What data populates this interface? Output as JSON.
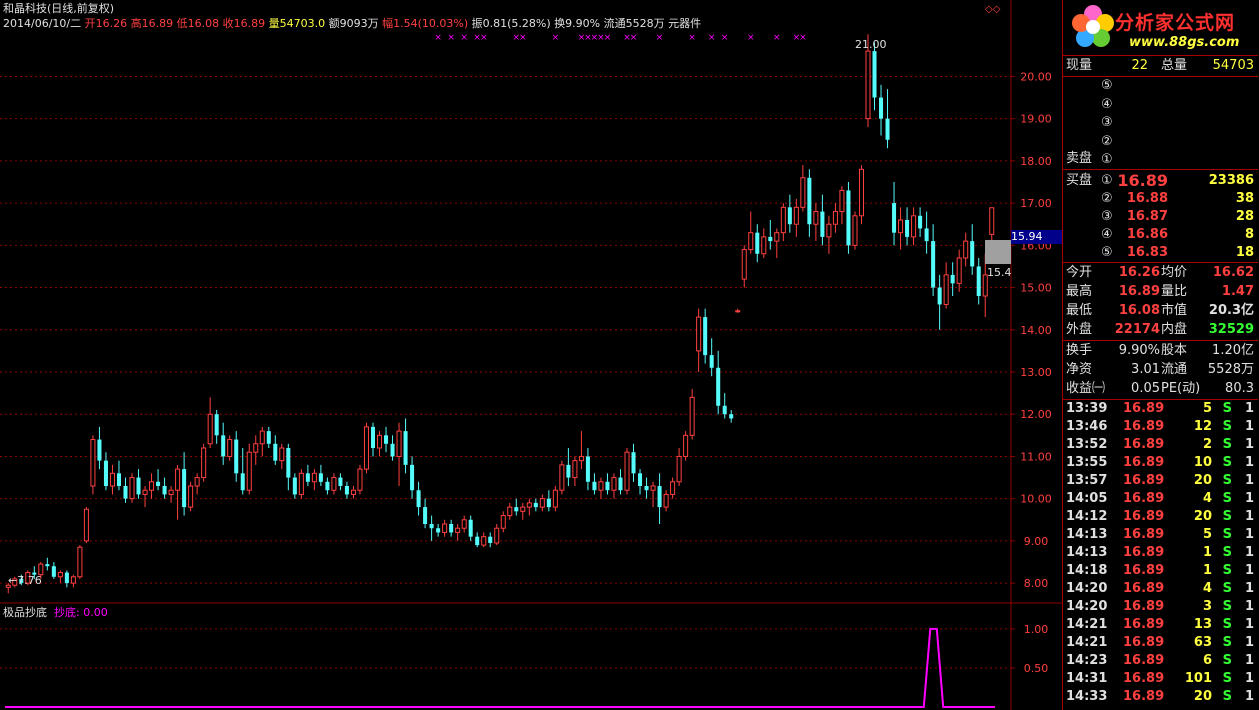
{
  "header": {
    "stock_name": "和晶科技(日线,前复权)",
    "date": "2014/06/10/二",
    "open_label": "开",
    "open": "16.26",
    "high_label": "高",
    "high": "16.89",
    "low_label": "低",
    "low": "16.08",
    "close_label": "收",
    "close": "16.89",
    "vol_label": "量",
    "vol": "54703.0",
    "amount_label": "额",
    "amount": "9093万",
    "chg_label": "幅",
    "chg": "1.54(10.03%)",
    "amp": "振0.81(5.28%)",
    "turnover": "换9.90%",
    "float": "流通5528万",
    "sector": "元器件"
  },
  "annotations": {
    "max_label": "21.00",
    "min_label": "7.76",
    "price_tag": "15.94",
    "right_label": "15.4"
  },
  "indicator": {
    "name": "极品抄底",
    "series_label": "抄底: 0.00"
  },
  "chart_data": [
    {
      "type": "candlestick",
      "y_ticks": [
        "20.00",
        "19.00",
        "18.00",
        "17.00",
        "16.00",
        "15.00",
        "14.00",
        "13.00",
        "12.00",
        "11.00",
        "10.00",
        "9.00",
        "8.00"
      ],
      "ylim": [
        7.6,
        21.1
      ],
      "candles": [
        [
          7.9,
          8.0,
          7.76,
          7.95
        ],
        [
          7.95,
          8.15,
          7.9,
          8.1
        ],
        [
          8.1,
          8.2,
          7.95,
          8.0
        ],
        [
          8.0,
          8.3,
          7.95,
          8.25
        ],
        [
          8.25,
          8.4,
          8.1,
          8.2
        ],
        [
          8.2,
          8.5,
          8.1,
          8.45
        ],
        [
          8.45,
          8.6,
          8.3,
          8.4
        ],
        [
          8.4,
          8.5,
          8.1,
          8.15
        ],
        [
          8.15,
          8.3,
          8.0,
          8.25
        ],
        [
          8.25,
          8.3,
          7.9,
          8.0
        ],
        [
          8.0,
          8.2,
          7.9,
          8.15
        ],
        [
          8.15,
          8.9,
          8.1,
          8.85
        ],
        [
          9.0,
          9.8,
          8.95,
          9.75
        ],
        [
          10.3,
          11.5,
          10.1,
          11.4
        ],
        [
          11.4,
          11.7,
          10.7,
          10.9
        ],
        [
          10.9,
          11.1,
          10.2,
          10.3
        ],
        [
          10.3,
          10.8,
          10.1,
          10.6
        ],
        [
          10.6,
          10.9,
          10.2,
          10.3
        ],
        [
          10.3,
          10.5,
          9.9,
          10.0
        ],
        [
          10.0,
          10.6,
          9.9,
          10.5
        ],
        [
          10.5,
          10.7,
          10.0,
          10.1
        ],
        [
          10.1,
          10.3,
          9.8,
          10.2
        ],
        [
          10.2,
          10.6,
          10.0,
          10.4
        ],
        [
          10.4,
          10.7,
          10.2,
          10.3
        ],
        [
          10.3,
          10.5,
          10.0,
          10.1
        ],
        [
          10.1,
          10.3,
          9.9,
          10.2
        ],
        [
          10.2,
          10.8,
          9.5,
          10.7
        ],
        [
          10.7,
          11.1,
          9.6,
          9.8
        ],
        [
          9.8,
          10.4,
          9.7,
          10.3
        ],
        [
          10.3,
          10.6,
          10.1,
          10.5
        ],
        [
          10.5,
          11.3,
          10.4,
          11.2
        ],
        [
          11.3,
          12.4,
          11.2,
          12.0
        ],
        [
          12.0,
          12.1,
          11.3,
          11.5
        ],
        [
          11.5,
          11.8,
          10.8,
          11.0
        ],
        [
          11.0,
          11.5,
          10.9,
          11.4
        ],
        [
          11.4,
          11.6,
          10.4,
          10.6
        ],
        [
          10.6,
          11.2,
          10.1,
          10.2
        ],
        [
          10.2,
          11.3,
          10.1,
          11.1
        ],
        [
          11.1,
          11.5,
          10.8,
          11.3
        ],
        [
          11.3,
          11.7,
          11.0,
          11.6
        ],
        [
          11.6,
          11.7,
          11.2,
          11.3
        ],
        [
          11.3,
          11.5,
          10.8,
          10.9
        ],
        [
          10.9,
          11.3,
          10.7,
          11.2
        ],
        [
          11.2,
          11.3,
          10.2,
          10.5
        ],
        [
          10.5,
          10.6,
          10.0,
          10.1
        ],
        [
          10.1,
          10.7,
          10.0,
          10.6
        ],
        [
          10.6,
          10.8,
          10.3,
          10.4
        ],
        [
          10.4,
          10.7,
          10.2,
          10.6
        ],
        [
          10.6,
          10.8,
          10.3,
          10.4
        ],
        [
          10.4,
          10.5,
          10.1,
          10.2
        ],
        [
          10.2,
          10.6,
          10.1,
          10.5
        ],
        [
          10.5,
          10.6,
          10.2,
          10.3
        ],
        [
          10.3,
          10.4,
          10.0,
          10.1
        ],
        [
          10.1,
          10.3,
          10.0,
          10.2
        ],
        [
          10.2,
          10.8,
          10.1,
          10.7
        ],
        [
          10.7,
          11.8,
          10.6,
          11.7
        ],
        [
          11.7,
          11.8,
          11.0,
          11.2
        ],
        [
          11.2,
          11.6,
          11.0,
          11.5
        ],
        [
          11.5,
          11.7,
          11.1,
          11.3
        ],
        [
          11.3,
          11.5,
          10.9,
          11.0
        ],
        [
          11.0,
          11.8,
          10.3,
          11.6
        ],
        [
          11.6,
          11.9,
          10.6,
          10.8
        ],
        [
          10.8,
          11.0,
          10.0,
          10.2
        ],
        [
          10.2,
          10.4,
          9.6,
          9.8
        ],
        [
          9.8,
          10.0,
          9.3,
          9.4
        ],
        [
          9.4,
          9.6,
          9.0,
          9.3
        ],
        [
          9.3,
          9.4,
          9.1,
          9.2
        ],
        [
          9.2,
          9.5,
          9.1,
          9.4
        ],
        [
          9.4,
          9.5,
          9.1,
          9.2
        ],
        [
          9.2,
          9.4,
          9.0,
          9.3
        ],
        [
          9.3,
          9.6,
          9.2,
          9.5
        ],
        [
          9.5,
          9.6,
          9.0,
          9.1
        ],
        [
          9.1,
          9.2,
          8.85,
          8.9
        ],
        [
          8.9,
          9.2,
          8.85,
          9.1
        ],
        [
          9.1,
          9.2,
          8.85,
          8.95
        ],
        [
          8.95,
          9.4,
          8.9,
          9.3
        ],
        [
          9.3,
          9.7,
          9.2,
          9.6
        ],
        [
          9.6,
          9.9,
          9.5,
          9.8
        ],
        [
          9.8,
          10.0,
          9.6,
          9.7
        ],
        [
          9.7,
          9.9,
          9.5,
          9.8
        ],
        [
          9.8,
          10.0,
          9.6,
          9.9
        ],
        [
          9.9,
          10.0,
          9.7,
          9.8
        ],
        [
          9.8,
          10.1,
          9.7,
          10.0
        ],
        [
          10.0,
          10.2,
          9.7,
          9.8
        ],
        [
          9.8,
          10.3,
          9.7,
          10.2
        ],
        [
          10.2,
          10.9,
          10.1,
          10.8
        ],
        [
          10.8,
          11.2,
          10.3,
          10.5
        ],
        [
          10.5,
          11.0,
          10.3,
          10.9
        ],
        [
          10.9,
          11.6,
          10.7,
          11.0
        ],
        [
          11.0,
          11.2,
          10.2,
          10.4
        ],
        [
          10.4,
          10.6,
          10.1,
          10.2
        ],
        [
          10.2,
          10.5,
          10.0,
          10.4
        ],
        [
          10.4,
          10.6,
          10.1,
          10.2
        ],
        [
          10.2,
          10.6,
          10.0,
          10.5
        ],
        [
          10.5,
          10.7,
          10.1,
          10.2
        ],
        [
          10.2,
          11.2,
          10.1,
          11.1
        ],
        [
          11.1,
          11.3,
          10.4,
          10.6
        ],
        [
          10.6,
          10.7,
          10.1,
          10.3
        ],
        [
          10.3,
          10.5,
          10.0,
          10.2
        ],
        [
          10.2,
          10.4,
          9.8,
          10.3
        ],
        [
          10.3,
          10.6,
          9.4,
          9.8
        ],
        [
          9.8,
          10.2,
          9.7,
          10.1
        ],
        [
          10.1,
          10.5,
          10.0,
          10.4
        ],
        [
          10.4,
          11.2,
          10.3,
          11.0
        ],
        [
          11.0,
          11.6,
          10.9,
          11.5
        ],
        [
          11.5,
          12.6,
          11.4,
          12.4
        ],
        [
          13.5,
          14.5,
          13.0,
          14.3
        ],
        [
          14.3,
          14.5,
          13.2,
          13.4
        ],
        [
          13.4,
          13.8,
          12.9,
          13.1
        ],
        [
          13.1,
          13.5,
          12.0,
          12.2
        ],
        [
          12.2,
          12.5,
          11.9,
          12.0
        ],
        [
          12.0,
          12.1,
          11.8,
          11.9
        ],
        [
          14.45,
          14.5,
          14.4,
          14.45
        ],
        [
          15.2,
          16.0,
          15.0,
          15.9
        ],
        [
          15.9,
          16.8,
          15.8,
          16.3
        ],
        [
          16.3,
          16.5,
          15.6,
          15.8
        ],
        [
          15.8,
          16.4,
          15.7,
          16.2
        ],
        [
          16.2,
          16.6,
          15.9,
          16.1
        ],
        [
          16.1,
          16.4,
          15.7,
          16.3
        ],
        [
          16.3,
          17.0,
          16.1,
          16.9
        ],
        [
          16.9,
          17.2,
          16.3,
          16.5
        ],
        [
          16.5,
          17.1,
          16.2,
          16.9
        ],
        [
          16.9,
          17.9,
          16.8,
          17.6
        ],
        [
          17.6,
          17.8,
          16.2,
          16.5
        ],
        [
          16.5,
          17.0,
          16.1,
          16.8
        ],
        [
          16.8,
          17.2,
          16.0,
          16.2
        ],
        [
          16.2,
          16.7,
          15.8,
          16.5
        ],
        [
          16.5,
          17.0,
          16.3,
          16.8
        ],
        [
          16.8,
          17.4,
          16.5,
          17.3
        ],
        [
          17.3,
          17.5,
          15.8,
          16.0
        ],
        [
          16.0,
          16.8,
          15.9,
          16.7
        ],
        [
          16.7,
          17.9,
          16.5,
          17.8
        ],
        [
          19.0,
          21.0,
          18.8,
          20.6
        ],
        [
          20.6,
          20.8,
          19.2,
          19.5
        ],
        [
          19.5,
          19.8,
          18.6,
          19.0
        ],
        [
          19.0,
          19.7,
          18.3,
          18.5
        ],
        [
          17.0,
          17.5,
          16.0,
          16.3
        ],
        [
          16.3,
          16.9,
          15.9,
          16.6
        ],
        [
          16.6,
          16.9,
          16.0,
          16.2
        ],
        [
          16.2,
          16.9,
          16.0,
          16.7
        ],
        [
          16.7,
          16.9,
          16.2,
          16.4
        ],
        [
          16.4,
          16.8,
          15.8,
          16.1
        ],
        [
          16.1,
          16.5,
          14.8,
          15.0
        ],
        [
          15.0,
          15.3,
          14.0,
          14.6
        ],
        [
          14.6,
          15.6,
          14.5,
          15.3
        ],
        [
          15.3,
          15.6,
          14.8,
          15.1
        ],
        [
          15.1,
          15.9,
          14.9,
          15.7
        ],
        [
          15.7,
          16.3,
          15.5,
          16.1
        ],
        [
          16.1,
          16.5,
          15.3,
          15.5
        ],
        [
          15.5,
          15.7,
          14.6,
          14.8
        ],
        [
          14.8,
          15.8,
          14.3,
          15.3
        ],
        [
          16.26,
          16.89,
          16.08,
          16.89
        ]
      ]
    },
    {
      "type": "line",
      "name": "抄底",
      "y_ticks": [
        "1.00",
        "0.50"
      ],
      "ylim": [
        0,
        1.05
      ],
      "values": [
        0,
        0,
        0,
        0,
        0,
        0,
        0,
        0,
        0,
        0,
        0,
        0,
        0,
        0,
        0,
        0,
        0,
        0,
        0,
        0,
        0,
        0,
        0,
        0,
        0,
        0,
        0,
        0,
        0,
        0,
        0,
        0,
        0,
        0,
        0,
        0,
        0,
        0,
        0,
        0,
        0,
        0,
        0,
        0,
        0,
        0,
        0,
        0,
        0,
        0,
        0,
        0,
        0,
        0,
        0,
        0,
        0,
        0,
        0,
        0,
        0,
        0,
        0,
        0,
        0,
        0,
        0,
        0,
        0,
        0,
        0,
        0,
        0,
        0,
        0,
        0,
        0,
        0,
        0,
        0,
        0,
        0,
        0,
        0,
        0,
        0,
        0,
        0,
        0,
        0,
        0,
        0,
        0,
        0,
        0,
        0,
        0,
        0,
        0,
        0,
        0,
        0,
        0,
        0,
        0,
        0,
        0,
        0,
        0,
        0,
        0,
        0,
        0,
        0,
        0,
        0,
        0,
        0,
        0,
        0,
        0,
        0,
        0,
        0,
        0,
        0,
        0,
        0,
        0,
        0,
        0,
        0,
        0,
        0,
        0,
        0,
        0,
        0,
        0,
        0,
        0,
        0,
        0,
        1,
        1,
        0,
        0,
        0,
        0,
        0,
        0,
        0,
        0,
        0
      ]
    }
  ],
  "panel": {
    "logo_text": "分析家公式网",
    "logo_url_text": "www.88gs.com",
    "cur_vol_label": "现量",
    "cur_vol": "22",
    "total_vol_label": "总量",
    "total_vol": "54703",
    "sell_label": "卖盘",
    "buy_label": "买盘",
    "levels": [
      "⑤",
      "④",
      "③",
      "②",
      "①"
    ],
    "buy_levels": [
      "①",
      "②",
      "③",
      "④",
      "⑤"
    ],
    "buy": [
      {
        "price": "16.89",
        "vol": "23386"
      },
      {
        "price": "16.88",
        "vol": "38"
      },
      {
        "price": "16.87",
        "vol": "28"
      },
      {
        "price": "16.86",
        "vol": "8"
      },
      {
        "price": "16.83",
        "vol": "18"
      }
    ],
    "stats": [
      {
        "l1": "今开",
        "v1": "16.26",
        "c1": "red",
        "l2": "均价",
        "v2": "16.62",
        "c2": "red"
      },
      {
        "l1": "最高",
        "v1": "16.89",
        "c1": "red",
        "l2": "量比",
        "v2": "1.47",
        "c2": "red"
      },
      {
        "l1": "最低",
        "v1": "16.08",
        "c1": "red",
        "l2": "市值",
        "v2": "20.3亿",
        "c2": "white"
      },
      {
        "l1": "外盘",
        "v1": "22174",
        "c1": "red",
        "l2": "内盘",
        "v2": "32529",
        "c2": "green"
      }
    ],
    "fund": [
      {
        "l1": "换手",
        "v1": "9.90%",
        "l2": "股本",
        "v2": "1.20亿"
      },
      {
        "l1": "净资",
        "v1": "3.01",
        "l2": "流通",
        "v2": "5528万"
      },
      {
        "l1": "收益㈠",
        "v1": "0.05",
        "l2": "PE(动)",
        "v2": "80.3"
      }
    ],
    "ticks": [
      {
        "t": "13:39",
        "p": "16.89",
        "v": "5",
        "s": "S",
        "n": "1"
      },
      {
        "t": "13:46",
        "p": "16.89",
        "v": "12",
        "s": "S",
        "n": "1"
      },
      {
        "t": "13:52",
        "p": "16.89",
        "v": "2",
        "s": "S",
        "n": "1"
      },
      {
        "t": "13:55",
        "p": "16.89",
        "v": "10",
        "s": "S",
        "n": "1"
      },
      {
        "t": "13:57",
        "p": "16.89",
        "v": "20",
        "s": "S",
        "n": "1"
      },
      {
        "t": "14:05",
        "p": "16.89",
        "v": "4",
        "s": "S",
        "n": "1"
      },
      {
        "t": "14:12",
        "p": "16.89",
        "v": "20",
        "s": "S",
        "n": "1"
      },
      {
        "t": "14:13",
        "p": "16.89",
        "v": "5",
        "s": "S",
        "n": "1"
      },
      {
        "t": "14:13",
        "p": "16.89",
        "v": "1",
        "s": "S",
        "n": "1"
      },
      {
        "t": "14:18",
        "p": "16.89",
        "v": "1",
        "s": "S",
        "n": "1"
      },
      {
        "t": "14:20",
        "p": "16.89",
        "v": "4",
        "s": "S",
        "n": "1"
      },
      {
        "t": "14:20",
        "p": "16.89",
        "v": "3",
        "s": "S",
        "n": "1"
      },
      {
        "t": "14:21",
        "p": "16.89",
        "v": "13",
        "s": "S",
        "n": "1"
      },
      {
        "t": "14:21",
        "p": "16.89",
        "v": "63",
        "s": "S",
        "n": "1"
      },
      {
        "t": "14:23",
        "p": "16.89",
        "v": "6",
        "s": "S",
        "n": "1"
      },
      {
        "t": "14:31",
        "p": "16.89",
        "v": "101",
        "s": "S",
        "n": "1"
      },
      {
        "t": "14:33",
        "p": "16.89",
        "v": "20",
        "s": "S",
        "n": "1"
      }
    ]
  },
  "colors": {
    "up": "#ff4040",
    "down": "#54fcfc",
    "grid": "#8b0000",
    "magenta": "#ff00ff"
  }
}
